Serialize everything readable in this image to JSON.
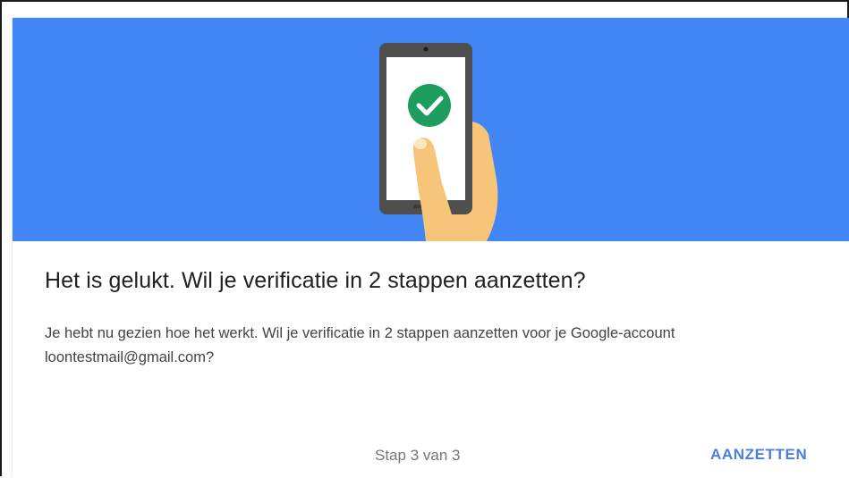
{
  "colors": {
    "hero_background": "#4285f4",
    "accent": "#4a7fe0",
    "check_circle": "#1e9e5e",
    "hand": "#f6c57a"
  },
  "illustration": {
    "icons": [
      "smartphone-icon",
      "check-circle-icon",
      "hand-icon"
    ]
  },
  "dialog": {
    "title": "Het is gelukt. Wil je verificatie in 2 stappen aanzetten?",
    "body": "Je hebt nu gezien hoe het werkt. Wil je verificatie in 2 stappen aanzetten voor je Google-account loontestmail@gmail.com?",
    "step_indicator": "Stap 3 van 3",
    "confirm_label": "AANZETTEN"
  }
}
